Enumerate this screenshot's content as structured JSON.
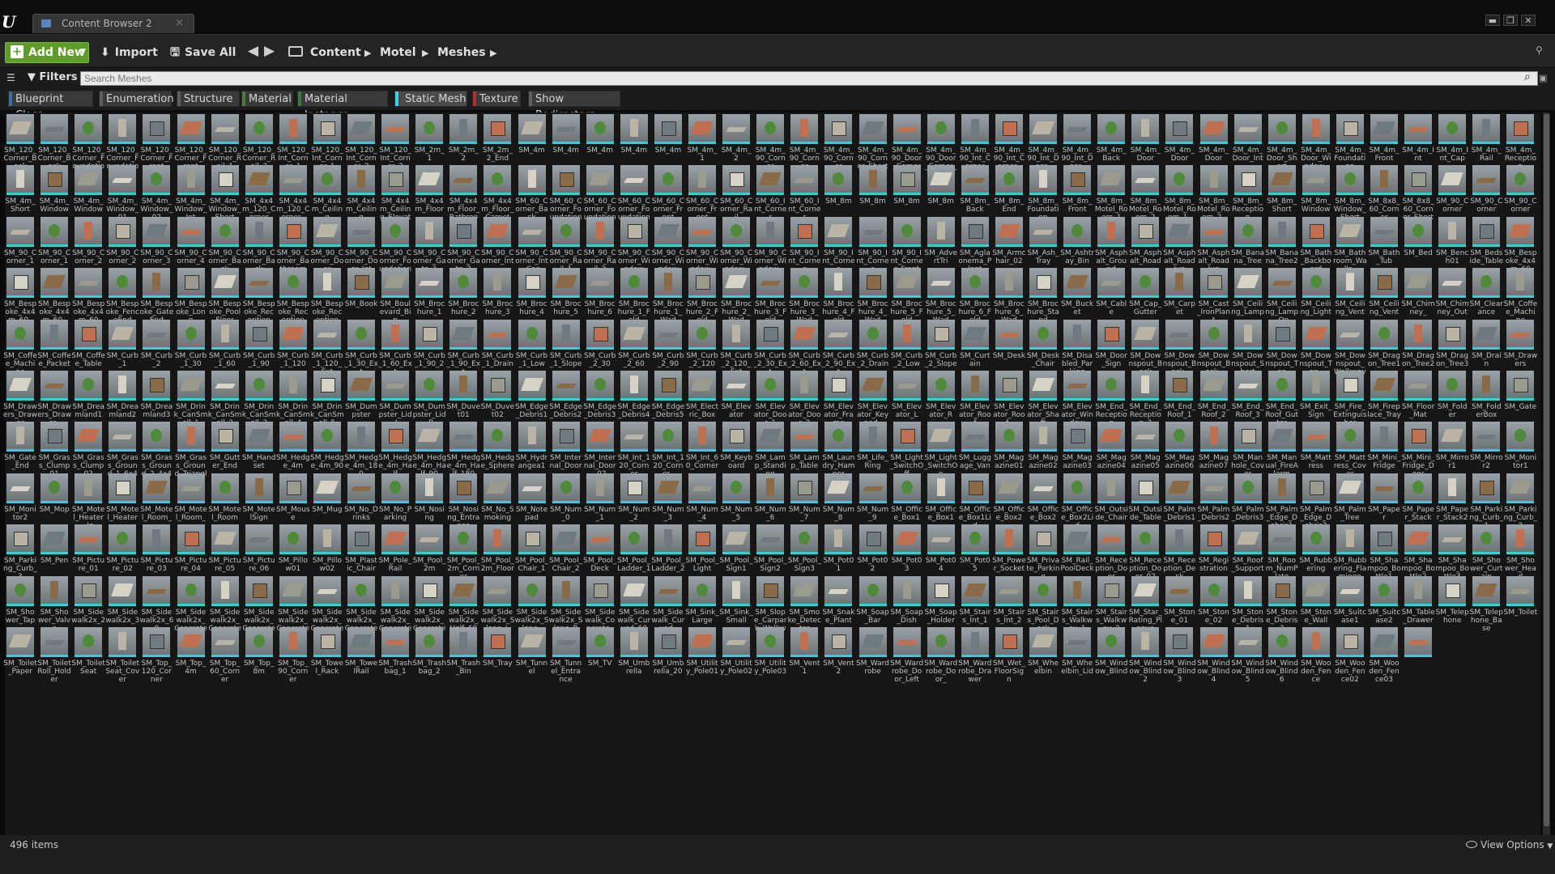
{
  "window": {
    "tab_title": "Content Browser 2",
    "logo": "U",
    "controls": [
      "▬",
      "❐",
      "✕"
    ]
  },
  "toolbar": {
    "add_new_label": "Add New",
    "import_label": "Import",
    "save_all_label": "Save All",
    "back_icon": "◀",
    "forward_icon": "▶",
    "breadcrumb": [
      "Content",
      "Motel",
      "Meshes"
    ]
  },
  "search": {
    "filters_label": "Filters",
    "placeholder": "Search Meshes"
  },
  "filter_chips": [
    {
      "label": "Blueprint Class",
      "color": "#3a6ea8",
      "active": false
    },
    {
      "label": "Enumeration",
      "color": "#5f5f5f",
      "active": false
    },
    {
      "label": "Structure",
      "color": "#5f5f5f",
      "active": false
    },
    {
      "label": "Material",
      "color": "#4b7d3a",
      "active": false
    },
    {
      "label": "Material Instance",
      "color": "#3f7a3f",
      "active": false
    },
    {
      "label": "Static Mesh",
      "color": "#33d7e0",
      "active": true
    },
    {
      "label": "Texture",
      "color": "#a73232",
      "active": false
    },
    {
      "label": "Show Redirectors",
      "color": "#5f5f5f",
      "active": false
    }
  ],
  "assets_visible": [
    "SM_120_Corner_Back",
    "SM_120_Corner_Back",
    "SM_120_Corner_Foundation",
    "SM_120_Corner_Foundation",
    "SM_120_Corner_Front",
    "SM_120_Corner_Front",
    "SM_120_Corner_Rail_1",
    "SM_120_Corner_Rail_2",
    "SM_120_Int_Corner_1",
    "SM_120_Int_Corner_1",
    "SM_120_Int_Corner_2",
    "SM_120_Int_Corner_2",
    "SM_2m_1",
    "SM_2m_2",
    "SM_2m_2_End",
    "SM_4m",
    "SM_4m",
    "SM_4m",
    "SM_4m",
    "SM_4m",
    "SM_4m_1",
    "SM_4m_2",
    "SM_4m_90_Corner",
    "SM_4m_90_Corner",
    "SM_4m_90_Corner",
    "SM_4m_90_Corner_Short",
    "SM_4m_90_Door_Corner",
    "SM_4m_90_Door_Corner_",
    "SM_4m_90_Int_Corner",
    "SM_4m_90_Int_Corner_",
    "SM_4m_90_Int_Door_",
    "SM_4m_90_Int_Door_",
    "SM_4m_Back",
    "SM_4m_Door",
    "SM_4m_Door",
    "SM_4m_Door",
    "SM_4m_Door_Int",
    "SM_4m_Door_Short",
    "SM_4m_Door_Window_",
    "SM_4m_Foundation",
    "SM_4m_Front",
    "SM_4m_Int",
    "SM_4m_Int_Cap",
    "SM_4m_Rail",
    "SM_4m_Reception",
    "SM_4m_Short",
    "SM_4m_Window",
    "SM_4m_Window",
    "SM_4m_Window_01",
    "SM_4m_Window_02",
    "SM_4m_Window_Int",
    "SM_4m_Window_Short",
    "SM_4x4m_120_Corner",
    "SM_4x4m_120_Corner_",
    "SM_4x4m_Ceiling",
    "SM_4x4m_Ceiling",
    "SM_4x4m_Ceiling_Elevator",
    "SM_4x4m_Floor",
    "SM_4x4m_Floor_Bathroom",
    "SM_4x4m_Floor_Carpet",
    "SM_60_Corner_Back",
    "SM_60_Corner_Foundation",
    "SM_60_Corner_Foundation",
    "SM_60_Corner_Foundation",
    "SM_60_Corner_Front",
    "SM_60_Corner_Front",
    "SM_60_Corner_Rail",
    "SM_60_Int_Corner",
    "SM_60_Int_Corner",
    "SM_8m",
    "SM_8m",
    "SM_8m",
    "SM_8m",
    "SM_8m_Back",
    "SM_8m_End",
    "SM_8m_Foundation",
    "SM_8m_Front",
    "SM_8m_Motel_Room_1",
    "SM_8m_Motel_Room_2",
    "SM_8m_Motel_Room_1_",
    "SM_8m_Motel_Room_2_",
    "SM_8m_Reception",
    "SM_8m_Short",
    "SM_8m_Window",
    "SM_8m_Window_Short",
    "SM_8x8_60_Corner",
    "SM_8x8_60_Corner_Short",
    "SM_90_Corner",
    "SM_90_Corner",
    "SM_90_Corner",
    "SM_90_Corner_1",
    "SM_90_Corner_1",
    "SM_90_Corner_2",
    "SM_90_Corner_2",
    "SM_90_Corner_3",
    "SM_90_Corner_4",
    "SM_90_Corner_Back",
    "SM_90_Corner_Back",
    "SM_90_Corner_Bathroom",
    "SM_90_Corner_Door",
    "SM_90_Corner_Door_Int",
    "SM_90_Corner_Foundation",
    "SM_90_Corner_Gate_1",
    "SM_90_Corner_Gate_2",
    "SM_90_Corner_Int",
    "SM_90_Corner_Int_Cap",
    "SM_90_Corner_Rail_1",
    "SM_90_Corner_Rail_2",
    "SM_90_Corner_Window",
    "SM_90_Corner_Window",
    "SM_90_Corner_Window_",
    "SM_90_Corner_Window_",
    "SM_90_Corner_Window_",
    "SM_90_Int_Corner",
    "SM_90_Int_Corner",
    "SM_90_Int_Corner",
    "SM_90_Int_Corner_Front",
    "SM_AdvertTri",
    "SM_Aglaonema_Plant",
    "SM_Armchair_02",
    "SM_Ash_Tray",
    "SM_Ashtray_Bin",
    "SM_Asphalt_Ground",
    "SM_Asphalt_Road",
    "SM_Asphalt_Road_Jun_",
    "SM_Asphalt_Road_Jun_",
    "SM_Banana_Tree",
    "SM_Banana_Tree2",
    "SM_Bath_Backboard",
    "SM_Bathroom_Walls_",
    "SM_Bath_Tub",
    "SM_Bed",
    "SM_Bench01",
    "SM_Bedside_Table",
    "SM_Bespoke_4x4m_60",
    "SM_Bespoke_4x4m_60_",
    "SM_Bespoke_4x4m_60_",
    "SM_Bespoke_4x4m_60",
    "SM_Bespoke_FenceEnd",
    "SM_Bespoke_GateEnd",
    "SM_Bespoke_Long",
    "SM_Bespoke_PoolFloor",
    "SM_Bespoke_Reception",
    "SM_Bespoke_Reception",
    "SM_Bespoke_Reception",
    "SM_Book",
    "SM_Boulevard_Bin",
    "SM_Brochure_1",
    "SM_Brochure_2",
    "SM_Brochure_3",
    "SM_Brochure_4",
    "SM_Brochure_5",
    "SM_Brochure_6",
    "SM_Brochure_1_Fold",
    "SM_Brochure_1_Wad",
    "SM_Brochure_2_Fold",
    "SM_Brochure_2_Wad",
    "SM_Brochure_3_Fold",
    "SM_Brochure_3_Wad",
    "SM_Brochure_4_Fold",
    "SM_Brochure_4_Wad",
    "SM_Brochure_5_Fold",
    "SM_Brochure_5_Wad",
    "SM_Brochure_6_Fold",
    "SM_Brochure_6_Wad",
    "SM_Brochure_Stand",
    "SM_Bucket",
    "SM_Cable",
    "SM_Cap_Gutter",
    "SM_Carpet",
    "SM_Cast_IronPlant",
    "SM_Ceiling_Lamp",
    "SM_Ceiling_Lamp_On",
    "SM_Ceiling_Light",
    "SM_Ceiling_Vent",
    "SM_Ceiling_Vent",
    "SM_Chimney_",
    "SM_Chimney_Out",
    "SM_Clearance",
    "SM_Coffee_Machine",
    "SM_Coffee_Machine",
    "SM_Coffee_Packet",
    "SM_Coffee_Table",
    "SM_Curb_1",
    "SM_Curb_2",
    "SM_Curb_1_30",
    "SM_Curb_1_60",
    "SM_Curb_1_90",
    "SM_Curb_1_120",
    "SM_Curb_1_120_Ext",
    "SM_Curb_1_30_Ext",
    "SM_Curb_1_60_Ext",
    "SM_Curb_1_90_2",
    "SM_Curb_1_90_Ext",
    "SM_Curb_1_Drain",
    "SM_Curb_1_Low",
    "SM_Curb_1_Slope",
    "SM_Curb_2_30",
    "SM_Curb_2_60",
    "SM_Curb_2_90",
    "SM_Curb_2_120",
    "SM_Curb_2_120_Ext",
    "SM_Curb_2_30_Ext",
    "SM_Curb_2_60_Ext",
    "SM_Curb_2_90_Ext",
    "SM_Curb_2_Drain",
    "SM_Curb_2_Low",
    "SM_Curb_2_Slope",
    "SM_Curtain",
    "SM_Desk",
    "SM_Desk_Chair",
    "SM_Disabled_Parking",
    "SM_Door_Sign",
    "SM_Downspout_Back",
    "SM_Downspout_Back_",
    "SM_Downspout_Back_",
    "SM_Downspout_Short",
    "SM_Downspout_Top",
    "SM_Downspout_Top_",
    "SM_Downspout_Walkway",
    "SM_Dragon_Tree1",
    "SM_Dragon_Tree2",
    "SM_Dragon_Tree3",
    "SM_Drain",
    "SM_Drawers",
    "SM_Drawers_Drawer",
    "SM_Drawers_Drawer_",
    "SM_Dreamland1",
    "SM_Dreamland2",
    "SM_Dreamland3",
    "SM_Drink_CanSmall_1",
    "SM_Drink_CanSmall_2",
    "SM_Drink_CanSmall_3",
    "SM_Drink_CanSmall_4",
    "SM_Drink_CanSmall_5",
    "SM_Dumpster",
    "SM_Dumpster_Lid_L",
    "SM_Dumpster_Lid_R",
    "SM_Duvet01",
    "SM_Duvet02",
    "SM_Edge_Debris1",
    "SM_Edge_Debris2",
    "SM_Edge_Debris3",
    "SM_Edge_Debris4",
    "SM_Edge_Debris5",
    "SM_Electric_Box",
    "SM_Elevator",
    "SM_Elevator_Door_1",
    "SM_Elevator_Door_2",
    "SM_Elevator_Frame",
    "SM_Elevator_Keypad_",
    "SM_Elevator_L",
    "SM_Elevator_R",
    "SM_Elevator_Roof",
    "SM_Elevator_Roof_",
    "SM_Elevator_Shaft",
    "SM_Elevator_Window",
    "SM_End_Reception",
    "SM_End_Reception_2",
    "SM_End_Roof_1",
    "SM_End_Roof_2",
    "SM_End_Roof_3",
    "SM_End_Roof_Gutter",
    "SM_Exit_Sign",
    "SM_Fire_Extinguisher",
    "SM_Fireplace_Tray",
    "SM_Floor_Mat",
    "SM_Folder",
    "SM_FolderBox",
    "SM_Gate",
    "SM_Gate_End",
    "SM_Grass_Clump01",
    "SM_Grass_Clump02",
    "SM_Grass_Ground_1_6x4",
    "SM_Grass_Ground_2_4x4",
    "SM_Grass_Ground_Triangle",
    "SM_Gutter_End",
    "SM_Handset",
    "SM_Hedge_4m",
    "SM_Hedge_4m_90",
    "SM_Hedge_4m_180",
    "SM_Hedge_4m_Half",
    "SM_Hedge_4m_Half_90",
    "SM_Hedge_4m_Half_180",
    "SM_Hedge_Sphere",
    "SM_Hydrangea1",
    "SM_Internal_Door",
    "SM_Internal_Door_02",
    "SM_Int_120_Corner",
    "SM_Int_120_Corner_",
    "SM_Int_60_Corner",
    "SM_Keyboard",
    "SM_Lamp_Standing",
    "SM_Lamp_Table",
    "SM_Laundry_Hamper",
    "SM_Life_Ring",
    "SM_Light_SwitchOff",
    "SM_Light_SwitchOn",
    "SM_Luggage_Van",
    "SM_Magazine01",
    "SM_Magazine02",
    "SM_Magazine03",
    "SM_Magazine04",
    "SM_Magazine05",
    "SM_Magazine06",
    "SM_Magazine07",
    "SM_Manhole_Cover",
    "SM_Manual_FireAlarm",
    "SM_Mattress",
    "SM_Mattress_Cover",
    "SM_Mini_Fridge",
    "SM_Mini_Fridge_Door",
    "SM_Mirror1",
    "SM_Mirror2",
    "SM_Monitor1",
    "SM_Monitor2",
    "SM_Mop",
    "SM_Motel_Heater_In",
    "SM_Motel_Heater_",
    "SM_Motel_Room_",
    "SM_Motel_Room_",
    "SM_Motel_Room",
    "SM_MotelSign",
    "SM_Mouse",
    "SM_Mug",
    "SM_No_Drinks",
    "SM_No_Parking",
    "SM_Nosing",
    "SM_Nosing_Entrance",
    "SM_No_Smoking",
    "SM_Notepad",
    "SM_Num_0",
    "SM_Num_1",
    "SM_Num_2",
    "SM_Num_3",
    "SM_Num_4",
    "SM_Num_5",
    "SM_Num_6",
    "SM_Num_7",
    "SM_Num_8",
    "SM_Num_9",
    "SM_Office_Box1",
    "SM_Office_Box1",
    "SM_Office_Box1Lid",
    "SM_Office_Box2",
    "SM_Office_Box2",
    "SM_Office_Box2Lid",
    "SM_Outside_Chair",
    "SM_Outside_Table",
    "SM_Palm_Debris1",
    "SM_Palm_Debris2",
    "SM_Palm_Debris3",
    "SM_Palm_Edge_Debris1",
    "SM_Palm_Edge_Debris2",
    "SM_Palm_Tree",
    "SM_Paper",
    "SM_Paper_Stack",
    "SM_Paper_Stack2",
    "SM_Parking_Curb_1",
    "SM_Parking_Curb_2",
    "SM_Parking_Curb_3",
    "SM_Pen",
    "SM_Picture_01",
    "SM_Picture_02",
    "SM_Picture_03",
    "SM_Picture_04",
    "SM_Picture_05",
    "SM_Picture_06",
    "SM_Pillow01",
    "SM_Pillow02",
    "SM_Plastic_Chair",
    "SM_Pole_Rail",
    "SM_Pool_2m",
    "SM_Pool_2m_Corner",
    "SM_Pool_2m_Floor",
    "SM_Pool_Chair_1",
    "SM_Pool_Chair_2",
    "SM_Pool_Deck",
    "SM_Pool_Ladder_1",
    "SM_Pool_Ladder_2",
    "SM_Pool_Light",
    "SM_Pool_Sign1",
    "SM_Pool_Sign2",
    "SM_Pool_Sign3",
    "SM_Pot01",
    "SM_Pot02",
    "SM_Pot03",
    "SM_Pot04",
    "SM_Pot05",
    "SM_Power_Socket",
    "SM_Private_Parking",
    "SM_Rail_PoolDeck",
    "SM_Reception_Door",
    "SM_Reception_Door_02",
    "SM_Reception_Desk",
    "SM_Registration",
    "SM_Roof_Support",
    "SM_Room_NumPlate",
    "SM_Rubbering",
    "SM_Rubbering_Flamingo",
    "SM_Shampoo_Bottle1",
    "SM_Shampoo_Bottle2",
    "SM_Shampoo_Bottle3",
    "SM_Shower_Curtain",
    "SM_Shower_Head",
    "SM_Shower_Tap",
    "SM_Shower_Valve",
    "SM_Sidewalk2x_2",
    "SM_Sidewalk2x_3",
    "SM_Sidewalk2x_60",
    "SM_Sidewalk2x_Concrete",
    "SM_Sidewalk2x_Concrete",
    "SM_Sidewalk2x_Concrete",
    "SM_Sidewalk2x_Concrete",
    "SM_Sidewalk2x_Concrete",
    "SM_Sidewalk2x_Concrete",
    "SM_Sidewalk2x_Concrete",
    "SM_Sidewalk2x_Concrete",
    "SM_Sidewalk2x_Half_60",
    "SM_Sidewalk2x_Slope_L",
    "SM_Sidewalk2x_Slope_",
    "SM_Sidewalk2x_Slope_R",
    "SM_Sidewalk_Concrete_",
    "SM_Sidewalk_Curved_60",
    "SM_Sidewalk_Curved_",
    "SM_Sink_Large",
    "SM_Sink_Small",
    "SM_Slope_Carpark_Walkway",
    "SM_Smoke_Detector",
    "SM_Snake_Plant",
    "SM_Soap_Bar",
    "SM_Soap_Dish",
    "SM_Soap_Holder",
    "SM_Stairs_Int_1",
    "SM_Stairs_Int_2",
    "SM_Stairs_Pool_Deck",
    "SM_Stairs_Walkway_1",
    "SM_Stairs_Walkway_2",
    "SM_Star_Rating_Plaque",
    "SM_Stone_01",
    "SM_Stone_02",
    "SM_Stone_Debris1",
    "SM_Stone_Debris2",
    "SM_Stone_Wall",
    "SM_Suitcase1",
    "SM_Suitcase2",
    "SM_Table_Drawer",
    "SM_Telephone",
    "SM_Telephone_Base",
    "SM_Toilet",
    "SM_Toilet_Paper",
    "SM_ToiletRoll_Holder",
    "SM_ToiletSeat",
    "SM_ToiletSeat_Cover",
    "SM_Top_120_Corner",
    "SM_Top_4m",
    "SM_Top_60_Corner",
    "SM_Top_8m",
    "SM_Top_90_Corner",
    "SM_Towel_Rack",
    "SM_TowelRail",
    "SM_Trashbag_1",
    "SM_Trashbag_2",
    "SM_Trash_Bin",
    "SM_Tray",
    "SM_Tunnel",
    "SM_Tunnel_Entrance",
    "SM_TV",
    "SM_Umbrella",
    "SM_Umbrella_20",
    "SM_Utility_Pole01",
    "SM_Utility_Pole02",
    "SM_Utility_Pole03",
    "SM_Vent1",
    "SM_Vent2",
    "SM_Wardrobe",
    "SM_Wardrobe_Door_Left",
    "SM_Wardrobe_Door_",
    "SM_Wardrobe_Drawer",
    "SM_Wet_FloorSign",
    "SM_Wheelbin",
    "SM_Wheelbin_Lid",
    "SM_Window_Blind",
    "SM_Window_Blind2",
    "SM_Window_Blind3",
    "SM_Window_Blind4",
    "SM_Window_Blind5",
    "SM_Window_Blind6",
    "SM_Wooden_Fence",
    "SM_Wooden_Fence02",
    "SM_Wooden_Fence03",
    ""
  ],
  "status": {
    "item_count": "496 items",
    "view_options_label": "View Options"
  },
  "colors": {
    "static_mesh_accent": "#2fd0d8",
    "add_new_green": "#5e9d2b"
  }
}
